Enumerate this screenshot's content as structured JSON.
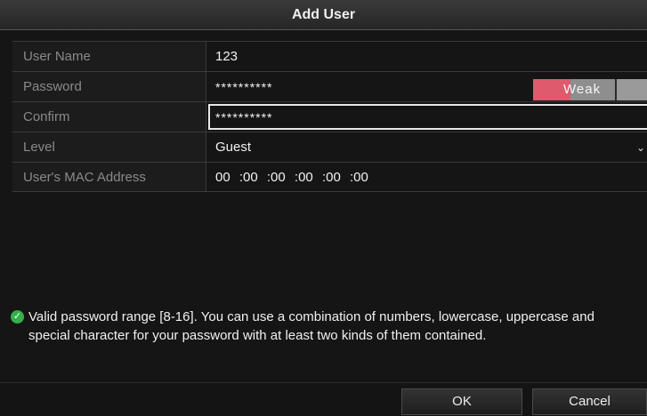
{
  "dialog": {
    "title": "Add User"
  },
  "form": {
    "user_name": {
      "label": "User Name",
      "value": "123"
    },
    "password": {
      "label": "Password",
      "value": "**********",
      "strength": "Weak"
    },
    "confirm": {
      "label": "Confirm",
      "value": "**********"
    },
    "level": {
      "label": "Level",
      "value": "Guest"
    },
    "mac": {
      "label": "User's MAC Address",
      "segments": [
        "00",
        ":00",
        ":00",
        ":00",
        ":00",
        ":00"
      ]
    }
  },
  "info": {
    "text": "Valid password range [8-16]. You can use a combination of numbers, lowercase, uppercase and special character for your password with at least two kinds of them contained."
  },
  "buttons": {
    "ok": "OK",
    "cancel": "Cancel"
  },
  "colors": {
    "weak": "#e05a6e",
    "valid": "#33b04a"
  },
  "icons": {
    "valid": "check-circle-icon",
    "level_dropdown": "chevron-down-icon"
  }
}
